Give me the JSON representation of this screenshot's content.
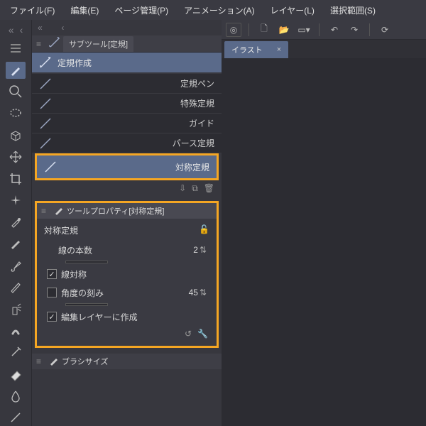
{
  "menu": [
    "ファイル(F)",
    "編集(E)",
    "ページ管理(P)",
    "アニメーション(A)",
    "レイヤー(L)",
    "選択範囲(S)"
  ],
  "subtool": {
    "header": "サブツール[定規]",
    "tab": "定規作成",
    "items": [
      "定規ペン",
      "特殊定規",
      "ガイド",
      "パース定規"
    ],
    "selected": "対称定規"
  },
  "props": {
    "header": "ツールプロパティ[対称定規]",
    "title": "対称定規",
    "lines_label": "線の本数",
    "lines_value": "2",
    "sym_label": "線対称",
    "angle_label": "角度の刻み",
    "angle_value": "45",
    "edit_layer": "編集レイヤーに作成"
  },
  "brush": {
    "header": "ブラシサイズ"
  },
  "doc_tab": "イラスト"
}
